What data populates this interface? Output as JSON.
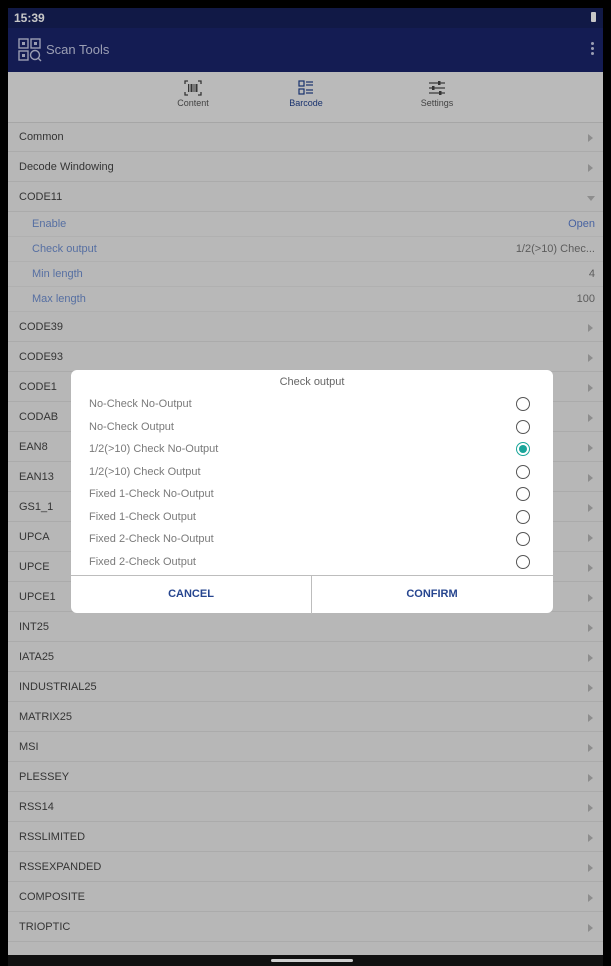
{
  "status_bar": {
    "time": "15:39"
  },
  "app_bar": {
    "title": "Scan Tools"
  },
  "tabs": [
    {
      "label": "Content",
      "icon": "barcode-scan-icon",
      "active": false
    },
    {
      "label": "Barcode",
      "icon": "list-icon",
      "active": true
    },
    {
      "label": "Settings",
      "icon": "sliders-icon",
      "active": false
    }
  ],
  "list": {
    "common": "Common",
    "decode_windowing": "Decode Windowing",
    "code11": "CODE11",
    "code11_settings": [
      {
        "label": "Enable",
        "value": "Open"
      },
      {
        "label": "Check output",
        "value": "1/2(>10) Chec..."
      },
      {
        "label": "Min length",
        "value": "4"
      },
      {
        "label": "Max length",
        "value": "100"
      }
    ],
    "items": [
      "CODE39",
      "CODE93",
      "CODE1",
      "CODAB",
      "EAN8",
      "EAN13",
      "GS1_1",
      "UPCA",
      "UPCE",
      "UPCE1",
      "INT25",
      "IATA25",
      "INDUSTRIAL25",
      "MATRIX25",
      "MSI",
      "PLESSEY",
      "RSS14",
      "RSSLIMITED",
      "RSSEXPANDED",
      "COMPOSITE",
      "TRIOPTIC"
    ]
  },
  "dialog": {
    "title": "Check output",
    "options": [
      {
        "label": "No-Check No-Output",
        "selected": false
      },
      {
        "label": "No-Check Output",
        "selected": false
      },
      {
        "label": "1/2(>10) Check No-Output",
        "selected": true
      },
      {
        "label": "1/2(>10) Check Output",
        "selected": false
      },
      {
        "label": "Fixed 1-Check No-Output",
        "selected": false
      },
      {
        "label": "Fixed 1-Check Output",
        "selected": false
      },
      {
        "label": "Fixed 2-Check No-Output",
        "selected": false
      },
      {
        "label": "Fixed 2-Check Output",
        "selected": false
      }
    ],
    "cancel_label": "CANCEL",
    "confirm_label": "CONFIRM"
  },
  "colors": {
    "app_bar": "#1a246b",
    "accent": "#1aa69a",
    "button_text": "#26458f"
  }
}
